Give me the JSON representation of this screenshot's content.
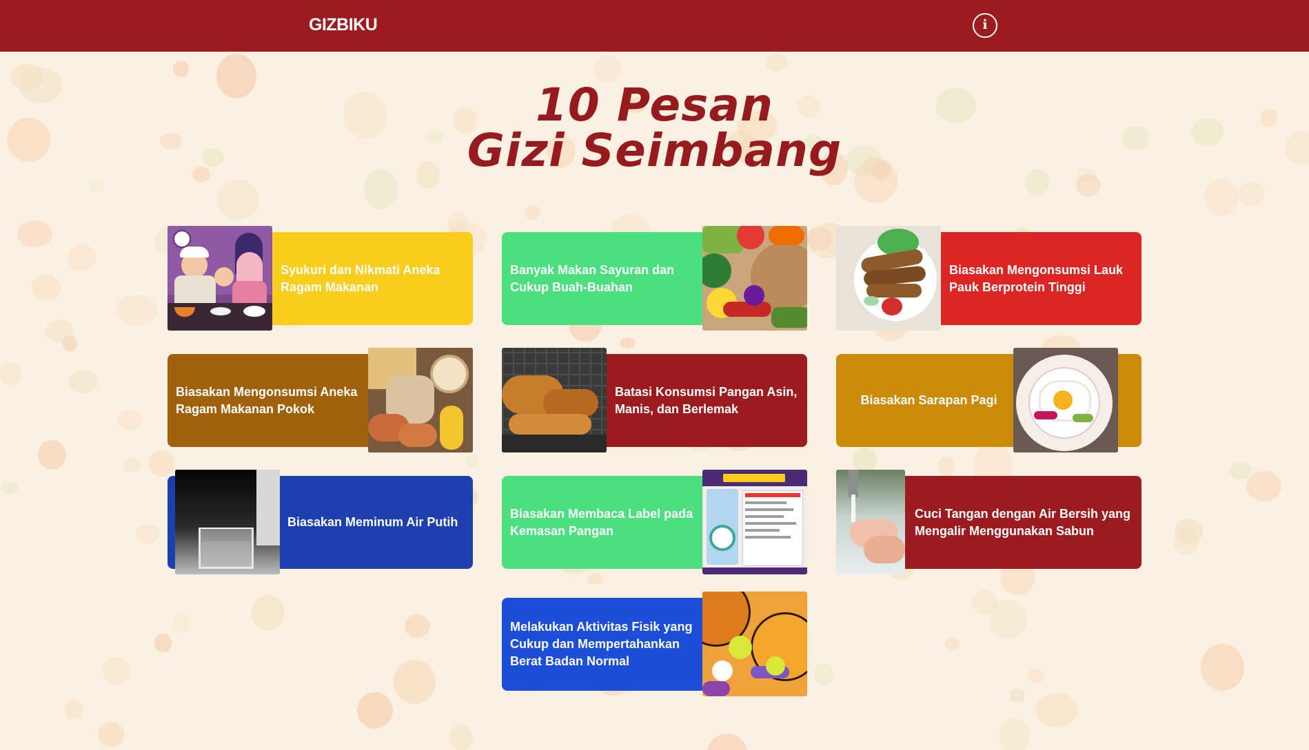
{
  "app": {
    "brand": "GIZBIKU",
    "info_icon": "info-icon"
  },
  "page": {
    "title_line1": "10 Pesan",
    "title_line2": "Gizi Seimbang"
  },
  "colors": {
    "navbar": "#9b1b1e",
    "background": "#fbf1e2",
    "title": "#951b1e"
  },
  "cards": [
    {
      "label": "Syukuri dan Nikmati Aneka Ragam Makanan",
      "color": "#f9cd1b",
      "image": "family-meal-illustration"
    },
    {
      "label": "Banyak Makan Sayuran dan Cukup Buah-Buahan",
      "color": "#4cdf80",
      "image": "vegetables-photo"
    },
    {
      "label": "Biasakan Mengonsumsi Lauk Pauk Berprotein Tinggi",
      "color": "#dc2626",
      "image": "fried-fish-photo"
    },
    {
      "label": "Biasakan Mengonsumsi Aneka Ragam Makanan Pokok",
      "color": "#a1600c",
      "image": "staple-foods-photo"
    },
    {
      "label": "Batasi Konsumsi Pangan Asin, Manis, dan Berlemak",
      "color": "#9b1b1e",
      "image": "fried-food-photo"
    },
    {
      "label": "Biasakan Sarapan Pagi",
      "color": "#cb8a08",
      "image": "breakfast-plate-photo"
    },
    {
      "label": "Biasakan Meminum Air Putih",
      "color": "#1e40af",
      "image": "glass-of-water-photo"
    },
    {
      "label": "Biasakan Membaca Label pada Kemasan Pangan",
      "color": "#4cdf80",
      "image": "food-label-infographic"
    },
    {
      "label": "Cuci Tangan dengan Air Bersih yang Mengalir Menggunakan Sabun",
      "color": "#9b1b1e",
      "image": "hand-washing-photo"
    },
    {
      "label": "Melakukan Aktivitas Fisik yang Cukup dan Mempertahankan Berat Badan Normal",
      "color": "#1d4ed8",
      "image": "sports-equipment-photo"
    }
  ]
}
